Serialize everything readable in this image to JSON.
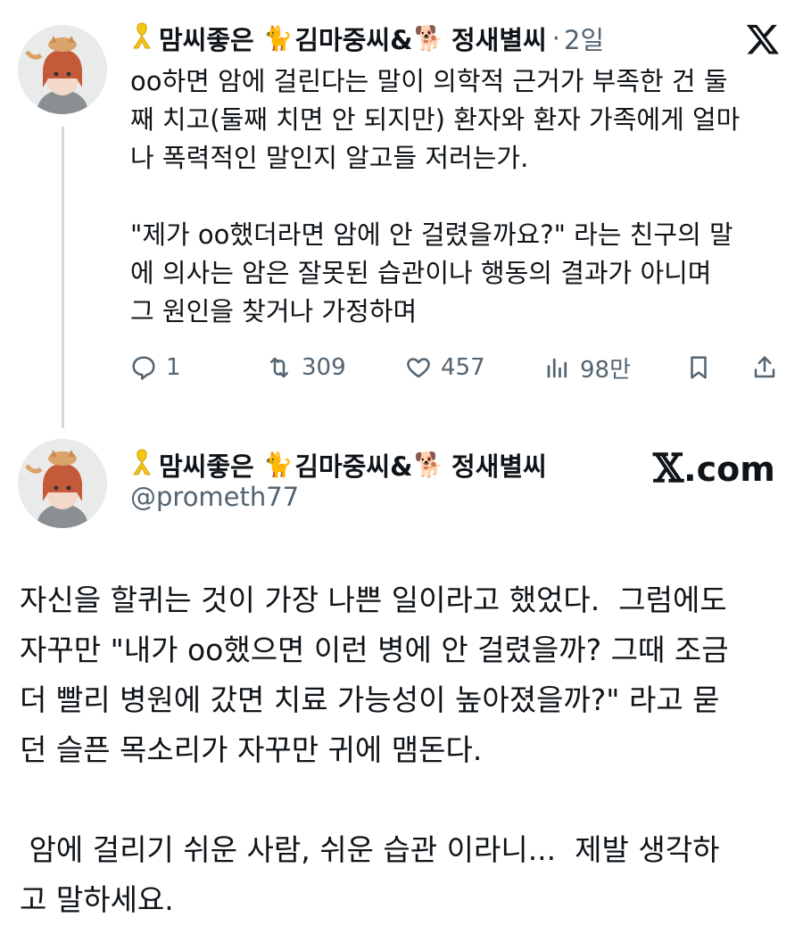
{
  "first_tweet": {
    "display_name_part1": "맘씨좋은",
    "display_name_part2": "김마중씨&",
    "display_name_part3": "정새별씨",
    "ribbon_icon": "yellow-ribbon-icon",
    "cat_icon": "cat-icon",
    "dog_icon": "dog-icon",
    "time_sep": "·",
    "time": "2일",
    "body": "oo하면 암에 걸린다는 말이 의학적 근거가 부족한 건 둘\n째 치고(둘째 치면 안 되지만) 환자와 환자 가족에게 얼마\n나 폭력적인 말인지 알고들 저러는가.\n\n\"제가 oo했더라면 암에 안 걸렸을까요?\" 라는 친구의 말\n에 의사는 암은 잘못된 습관이나 행동의 결과가 아니며\n그 원인을 찾거나 가정하며",
    "actions": {
      "replies": "1",
      "retweets": "309",
      "likes": "457",
      "views": "98만"
    }
  },
  "second_tweet": {
    "display_name_part1": "맘씨좋은",
    "display_name_part2": "김마중씨&",
    "display_name_part3": "정새별씨",
    "handle": "@prometh77",
    "source_mark": "𝕏",
    "source_domain": ".com",
    "body": "자신을 할퀴는 것이 가장 나쁜 일이라고 했었다.  그럼에도\n자꾸만 \"내가 oo했으면 이런 병에 안 걸렸을까? 그때 조금\n더 빨리 병원에 갔면 치료 가능성이 높아졌을까?\" 라고 묻\n던 슬픈 목소리가 자꾸만 귀에 맴돈다.\n\n 암에 걸리기 쉬운 사람, 쉬운 습관 이라니...  제발 생각하\n고 말하세요."
  },
  "colors": {
    "text": "#0f1419",
    "secondary": "#536471",
    "thread_line": "#cfd9de",
    "ribbon": "#f5c518"
  }
}
